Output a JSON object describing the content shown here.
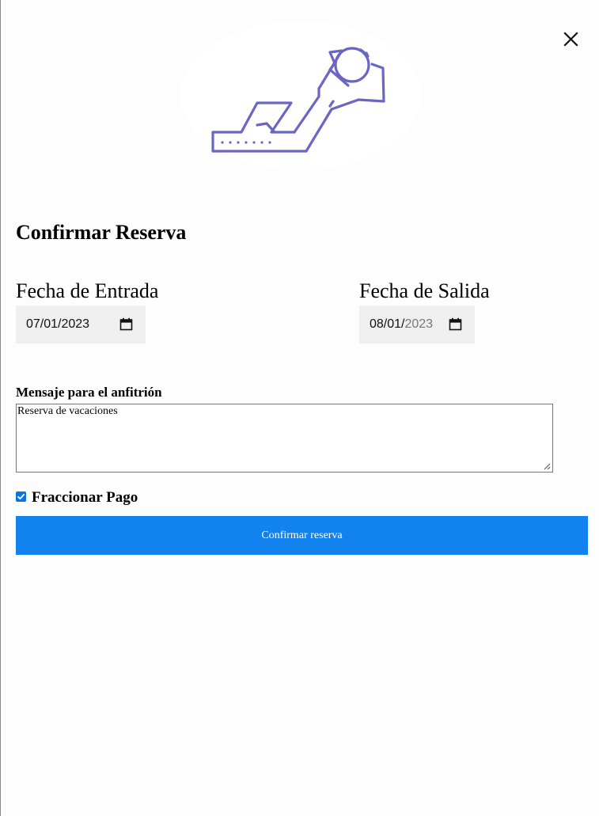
{
  "modal": {
    "close_icon": "close-icon",
    "illustration_icon": "person-relaxing-on-lounger-icon"
  },
  "form": {
    "title": "Confirmar Reserva",
    "check_in": {
      "label": "Fecha de Entrada",
      "value": "07/01/2023",
      "icon": "calendar-icon"
    },
    "check_out": {
      "label": "Fecha de Salida",
      "value_month_day": "08/01/",
      "value_year": "2023",
      "icon": "calendar-icon"
    },
    "message": {
      "label": "Mensaje para el anfitrión",
      "value": "Reserva de vacaciones"
    },
    "split_payment": {
      "label": "Fraccionar Pago",
      "checked": true
    },
    "submit_label": "Confirmar reserva"
  },
  "colors": {
    "accent": "#1282ef",
    "checkbox": "#0b74e5",
    "illustration_stroke": "#6a66c4",
    "background": "#fdfdfd"
  }
}
